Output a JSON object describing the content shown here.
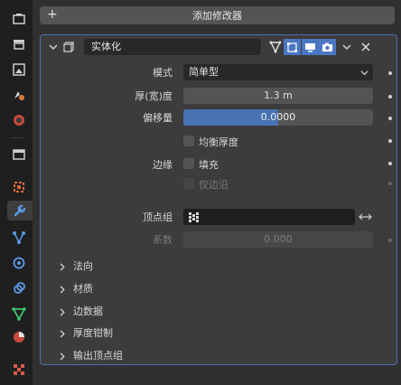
{
  "add_modifier": {
    "label": "添加修改器"
  },
  "modifier": {
    "name": "实体化",
    "rows": {
      "mode": {
        "label": "模式",
        "value": "简单型"
      },
      "thickness": {
        "label": "厚(宽)度",
        "value": "1.3 m"
      },
      "offset": {
        "label": "偏移量",
        "value": "0.0000",
        "fraction": 0.5
      },
      "even_thickness": {
        "label": "均衡厚度",
        "checked": false
      },
      "rim": {
        "label": "边缘",
        "fill_label": "填充",
        "fill_checked": false,
        "only_rim_label": "仅边沿",
        "only_rim_checked": false
      },
      "vertex_group": {
        "label": "顶点组",
        "value": ""
      },
      "factor": {
        "label": "系数",
        "value": "0.000"
      }
    },
    "subpanels": [
      "法向",
      "材质",
      "边数据",
      "厚度钳制",
      "输出顶点组"
    ]
  },
  "colors": {
    "accent": "#4772b3",
    "panel_border": "#4b6fb0",
    "active_toggle": "#4b76c2"
  }
}
